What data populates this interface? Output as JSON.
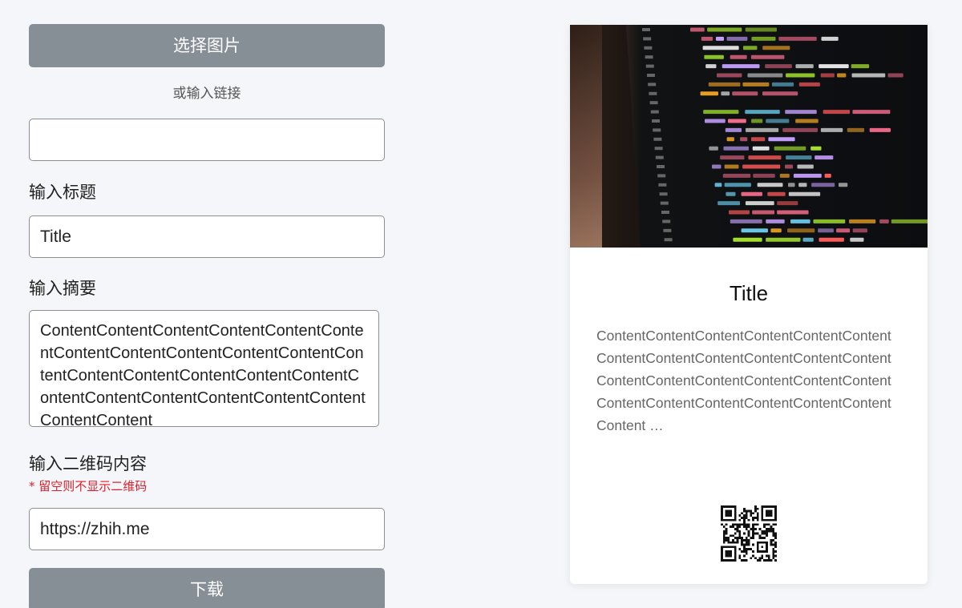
{
  "form": {
    "select_image_label": "选择图片",
    "or_link_text": "或输入链接",
    "image_url_value": "",
    "title_label": "输入标题",
    "title_value": "Title",
    "summary_label": "输入摘要",
    "summary_value": "ContentContentContentContentContentContentContentContentContentContentContentContentContentContentContentContentContentContentContentContentContentContentContentContentContent",
    "qr_label": "输入二维码内容",
    "qr_hint": "* 留空则不显示二维码",
    "qr_value": "https://zhih.me",
    "download_label": "下载"
  },
  "card": {
    "title": "Title",
    "summary": "ContentContentContentContentContentContentContentContentContentContentContentContentContentContentContentContentContentContentContentContentContentContentContentContentContent …",
    "cover_image": "code-editor-photo",
    "qr_icon": "qr-code-icon"
  },
  "colors": {
    "button_bg": "#868e96",
    "page_bg": "#f4f6f9",
    "hint": "#e0202a"
  }
}
